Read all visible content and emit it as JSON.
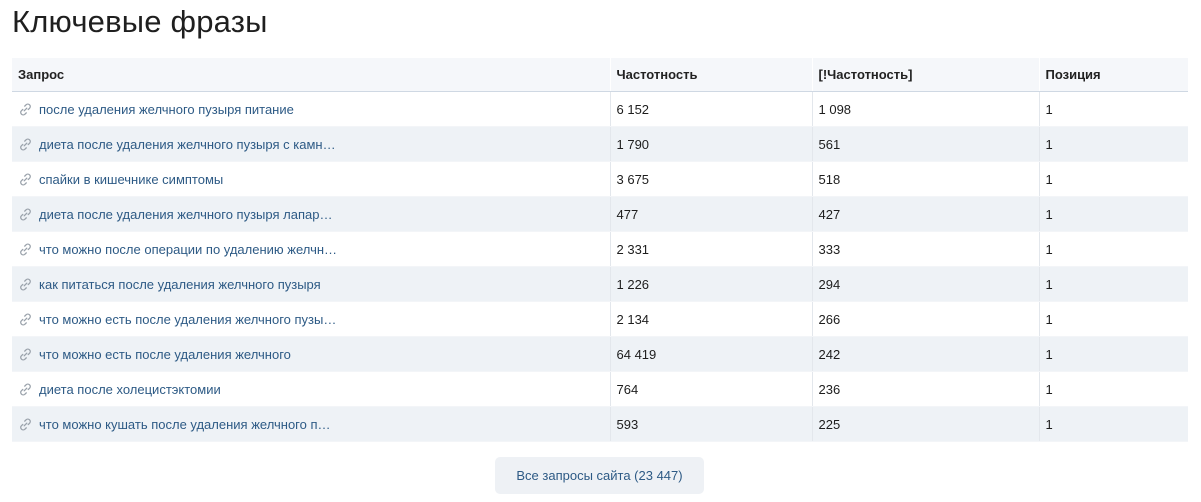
{
  "title": "Ключевые фразы",
  "table": {
    "headers": [
      "Запрос",
      "Частотность",
      "[!Частотность]",
      "Позиция"
    ],
    "rows": [
      {
        "query": "после удаления желчного пузыря питание",
        "freq": "6 152",
        "exact": "1 098",
        "pos": "1"
      },
      {
        "query": "диета после удаления желчного пузыря с камн…",
        "freq": "1 790",
        "exact": "561",
        "pos": "1"
      },
      {
        "query": "спайки в кишечнике симптомы",
        "freq": "3 675",
        "exact": "518",
        "pos": "1"
      },
      {
        "query": "диета после удаления желчного пузыря лапар…",
        "freq": "477",
        "exact": "427",
        "pos": "1"
      },
      {
        "query": "что можно после операции по удалению желчн…",
        "freq": "2 331",
        "exact": "333",
        "pos": "1"
      },
      {
        "query": "как питаться после удаления желчного пузыря",
        "freq": "1 226",
        "exact": "294",
        "pos": "1"
      },
      {
        "query": "что можно есть после удаления желчного пузы…",
        "freq": "2 134",
        "exact": "266",
        "pos": "1"
      },
      {
        "query": "что можно есть после удаления желчного",
        "freq": "64 419",
        "exact": "242",
        "pos": "1"
      },
      {
        "query": "диета после холецистэктомии",
        "freq": "764",
        "exact": "236",
        "pos": "1"
      },
      {
        "query": "что можно кушать после удаления желчного п…",
        "freq": "593",
        "exact": "225",
        "pos": "1"
      }
    ],
    "row_icon": "link-icon"
  },
  "all_queries_button": "Все запросы сайта (23 447)",
  "colors": {
    "link": "#2d5a85",
    "header_bg": "#f5f7fa",
    "stripe_bg": "#eef2f6",
    "button_bg": "#eef1f5"
  }
}
